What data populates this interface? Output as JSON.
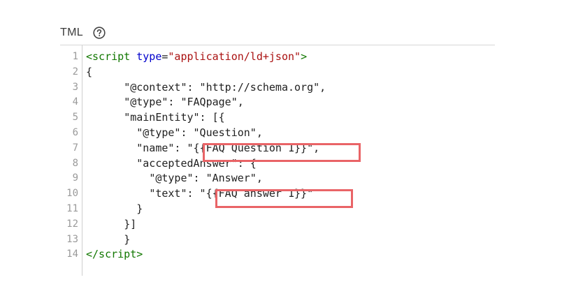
{
  "header": {
    "label": "TML",
    "help_icon": "question-circle-icon"
  },
  "editor": {
    "line_numbers": [
      "1",
      "2",
      "3",
      "4",
      "5",
      "6",
      "7",
      "8",
      "9",
      "10",
      "11",
      "12",
      "13",
      "14"
    ],
    "lines": [
      {
        "indent": "",
        "tokens": [
          {
            "t": "<script",
            "c": "tag"
          },
          {
            "t": " ",
            "c": "plain"
          },
          {
            "t": "type",
            "c": "attr"
          },
          {
            "t": "=",
            "c": "plain"
          },
          {
            "t": "\"application/ld+json\"",
            "c": "str"
          },
          {
            "t": ">",
            "c": "tag"
          }
        ]
      },
      {
        "indent": "",
        "tokens": [
          {
            "t": "{",
            "c": "plain"
          }
        ]
      },
      {
        "indent": "      ",
        "tokens": [
          {
            "t": "\"@context\": \"http://schema.org\",",
            "c": "plain"
          }
        ]
      },
      {
        "indent": "      ",
        "tokens": [
          {
            "t": "\"@type\": \"FAQpage\",",
            "c": "plain"
          }
        ]
      },
      {
        "indent": "      ",
        "tokens": [
          {
            "t": "\"mainEntity\": [{",
            "c": "plain"
          }
        ]
      },
      {
        "indent": "        ",
        "tokens": [
          {
            "t": "\"@type\": \"Question\",",
            "c": "plain"
          }
        ]
      },
      {
        "indent": "        ",
        "tokens": [
          {
            "t": "\"name\": \"{{FAQ Question 1}}\",",
            "c": "plain"
          }
        ]
      },
      {
        "indent": "        ",
        "tokens": [
          {
            "t": "\"acceptedAnswer\": {",
            "c": "plain"
          }
        ]
      },
      {
        "indent": "          ",
        "tokens": [
          {
            "t": "\"@type\": \"Answer\",",
            "c": "plain"
          }
        ]
      },
      {
        "indent": "          ",
        "tokens": [
          {
            "t": "\"text\": \"{{FAQ answer 1}}\"",
            "c": "plain"
          }
        ]
      },
      {
        "indent": "        ",
        "tokens": [
          {
            "t": "}",
            "c": "plain"
          }
        ]
      },
      {
        "indent": "      ",
        "tokens": [
          {
            "t": "}]",
            "c": "plain"
          }
        ]
      },
      {
        "indent": "      ",
        "tokens": [
          {
            "t": "}",
            "c": "plain"
          }
        ]
      },
      {
        "indent": "",
        "tokens": [
          {
            "t": "</script",
            "c": "tag"
          },
          {
            "t": ">",
            "c": "tag"
          }
        ]
      }
    ]
  },
  "colors": {
    "highlight": "#e96467",
    "tag": "#117700",
    "attr": "#0000cc",
    "string": "#aa1111",
    "line_number": "#9a9a9a"
  }
}
